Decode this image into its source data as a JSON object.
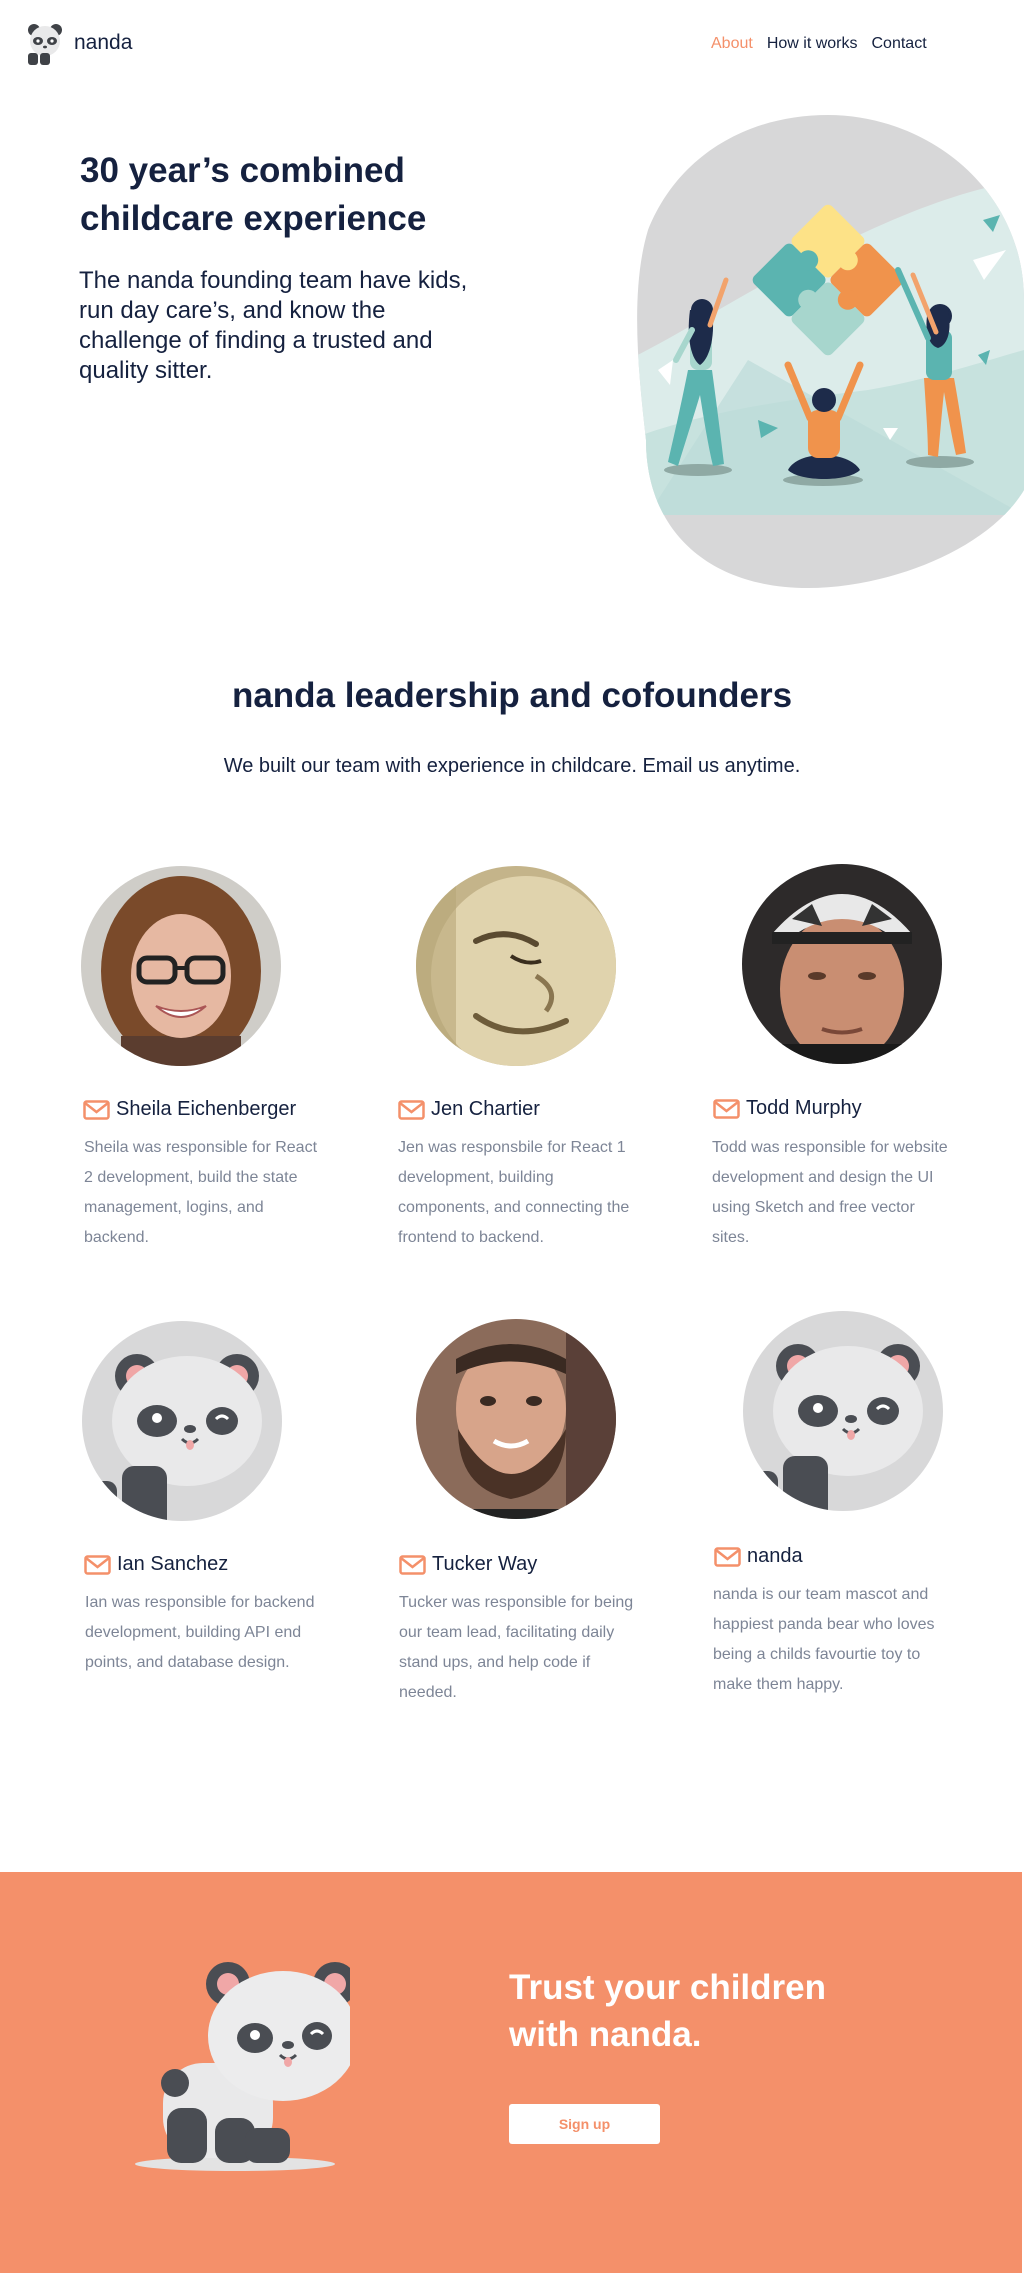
{
  "header": {
    "brand": "nanda",
    "logo_icon": "panda-logo-icon",
    "nav": [
      {
        "label": "About",
        "active": true
      },
      {
        "label": "How it works",
        "active": false
      },
      {
        "label": "Contact",
        "active": false
      }
    ]
  },
  "hero": {
    "title": "30 year’s combined childcare experience",
    "text": "The nanda founding team have kids, run day care’s, and know the challenge of finding a trusted and quality sitter.",
    "illustration": "puzzle-team-illustration"
  },
  "team": {
    "title": "nanda leadership and cofounders",
    "subtitle": "We built our team with experience in childcare. Email us anytime.",
    "members": [
      {
        "name": "Sheila Eichenberger",
        "description": "Sheila was responsible for React 2 development, build the state management, logins, and backend.",
        "photo": "sheila-photo"
      },
      {
        "name": "Jen Chartier",
        "description": "Jen was responsbile for React 1 development, building components, and connecting the frontend to backend.",
        "photo": "jen-photo"
      },
      {
        "name": "Todd Murphy",
        "description": "Todd was responsible for website development and design the UI using Sketch and free vector sites.",
        "photo": "todd-photo"
      },
      {
        "name": "Ian Sanchez",
        "description": "Ian was responsible for backend development, building API end points, and database design.",
        "photo": "panda-avatar"
      },
      {
        "name": "Tucker Way",
        "description": "Tucker was responsible for being our team lead, facilitating daily stand ups, and help code if needed.",
        "photo": "tucker-photo"
      },
      {
        "name": "nanda",
        "description": "nanda is our team mascot and happiest panda bear who loves being a childs favourtie toy to make them happy.",
        "photo": "panda-avatar"
      }
    ]
  },
  "cta": {
    "title": "Trust your children with nanda.",
    "button": "Sign up"
  },
  "colors": {
    "accent": "#f4906a",
    "navy": "#15213f",
    "muted": "#7d8596"
  }
}
